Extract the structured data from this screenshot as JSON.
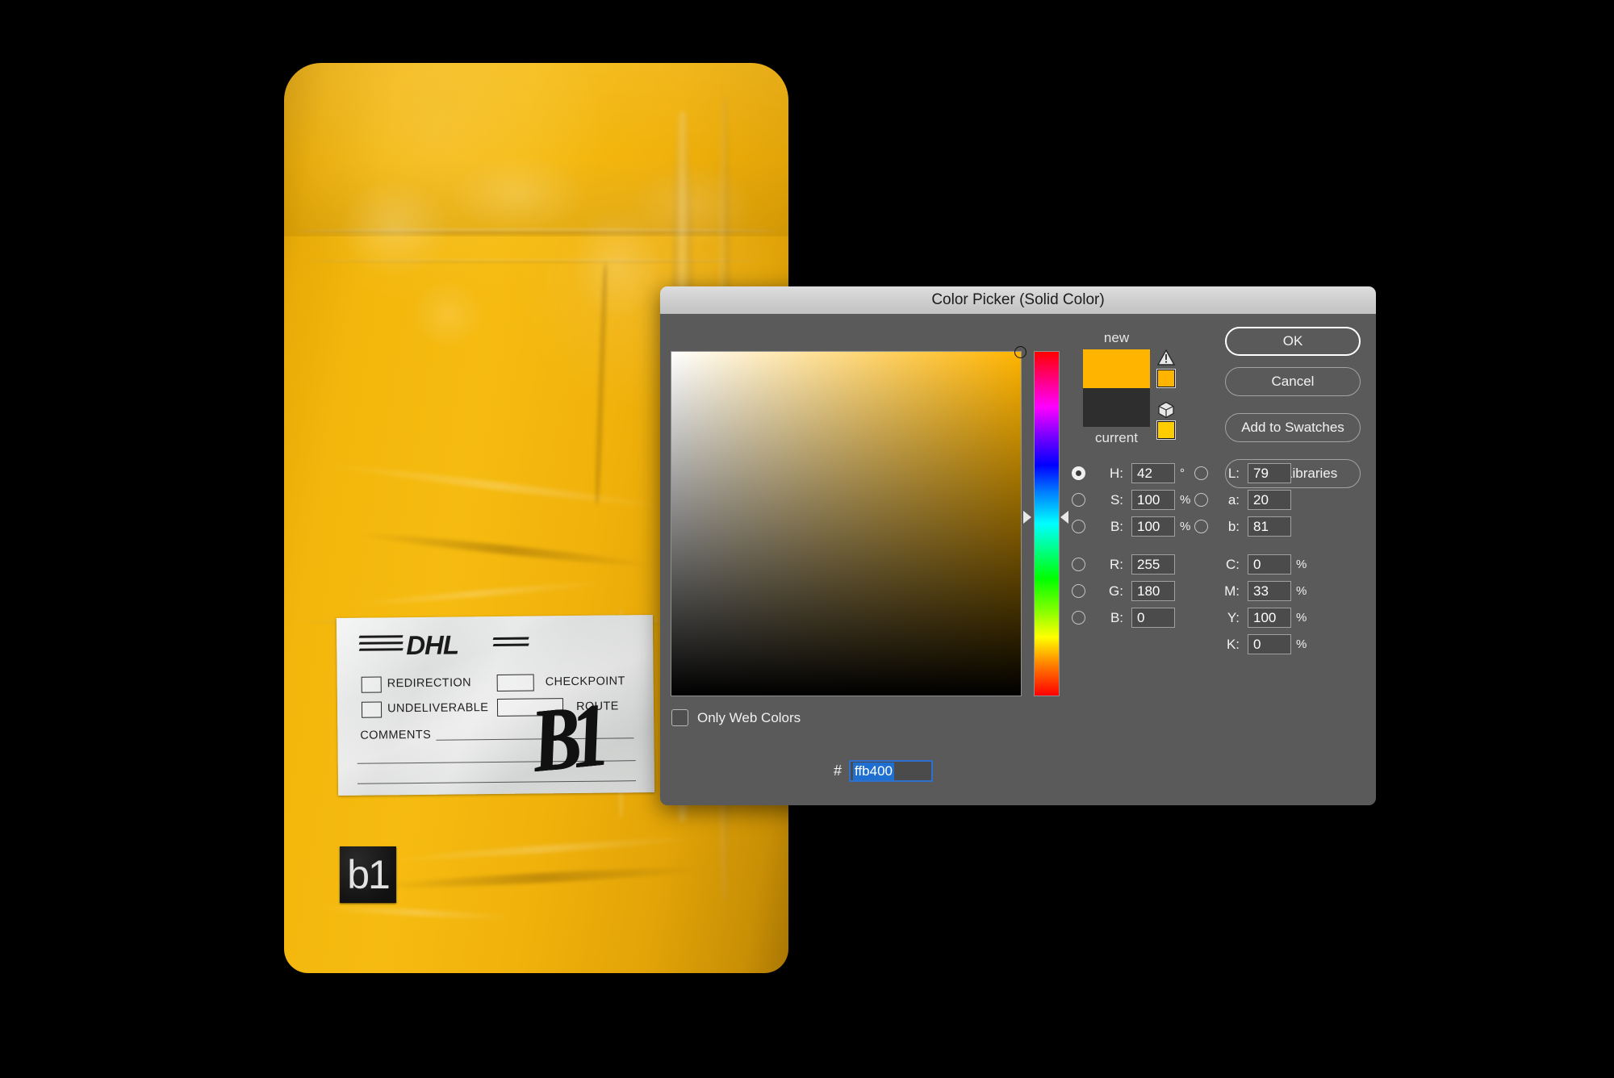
{
  "app": {
    "background_color": "#000000"
  },
  "photo": {
    "subject": "dhl-yellow-padded-envelope",
    "package_color": "#f3b70c",
    "sticker": {
      "text": "b1",
      "background": "#111111",
      "text_color": "#e2e2e2"
    },
    "label": {
      "brand": "DHL",
      "checkboxes": [
        {
          "label": "REDIRECTION"
        },
        {
          "label": "UNDELIVERABLE"
        }
      ],
      "fields": [
        {
          "label": "CHECKPOINT"
        },
        {
          "label": "ROUTE"
        }
      ],
      "comments_label": "COMMENTS",
      "signature": "B1"
    }
  },
  "dialog": {
    "title": "Color Picker (Solid Color)",
    "buttons": {
      "ok": "OK",
      "cancel": "Cancel",
      "add_to_swatches": "Add to Swatches",
      "color_libraries": "Color Libraries"
    },
    "swatches": {
      "new_label": "new",
      "current_label": "current",
      "new_color": "#ffb400",
      "current_color": "#2e2e2e",
      "gamut_warning_color": "#ffb400",
      "websafe_warning_color": "#ffcc00"
    },
    "only_web_colors": {
      "label": "Only Web Colors",
      "checked": false
    },
    "selected_model": "H",
    "hsb": [
      {
        "key": "H",
        "label": "H:",
        "value": "42",
        "unit": "°",
        "selected": true
      },
      {
        "key": "S",
        "label": "S:",
        "value": "100",
        "unit": "%",
        "selected": false
      },
      {
        "key": "B",
        "label": "B:",
        "value": "100",
        "unit": "%",
        "selected": false
      }
    ],
    "rgb": [
      {
        "key": "R",
        "label": "R:",
        "value": "255",
        "unit": "",
        "selected": false
      },
      {
        "key": "G",
        "label": "G:",
        "value": "180",
        "unit": "",
        "selected": false
      },
      {
        "key": "B2",
        "label": "B:",
        "value": "0",
        "unit": "",
        "selected": false
      }
    ],
    "lab": [
      {
        "key": "L",
        "label": "L:",
        "value": "79",
        "unit": "",
        "selected": false
      },
      {
        "key": "a",
        "label": "a:",
        "value": "20",
        "unit": "",
        "selected": false
      },
      {
        "key": "b",
        "label": "b:",
        "value": "81",
        "unit": "",
        "selected": false
      }
    ],
    "cmyk": [
      {
        "key": "C",
        "label": "C:",
        "value": "0",
        "unit": "%"
      },
      {
        "key": "M",
        "label": "M:",
        "value": "33",
        "unit": "%"
      },
      {
        "key": "Y",
        "label": "Y:",
        "value": "100",
        "unit": "%"
      },
      {
        "key": "K",
        "label": "K:",
        "value": "0",
        "unit": "%"
      }
    ],
    "hex": {
      "prefix": "#",
      "value": "ffb400",
      "selected": true
    },
    "field": {
      "hue_color": "#ffb400",
      "marker_saturation": 100,
      "marker_brightness": 100
    }
  }
}
